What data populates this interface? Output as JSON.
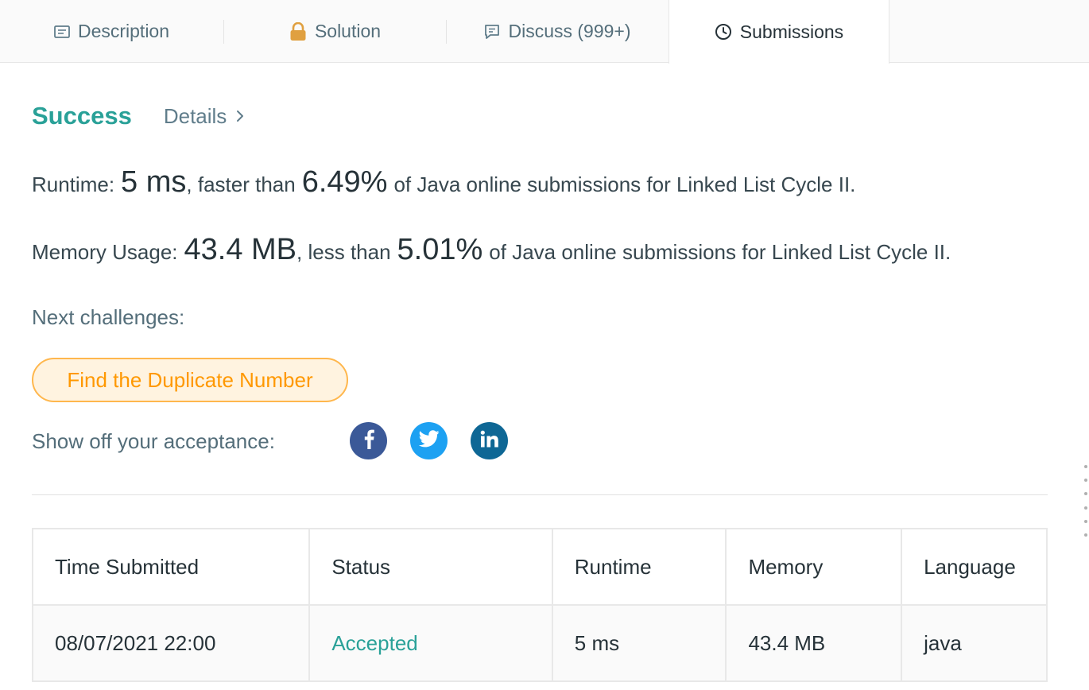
{
  "tabs": [
    {
      "label": "Description",
      "icon": "description-icon"
    },
    {
      "label": "Solution",
      "icon": "lock-icon"
    },
    {
      "label": "Discuss (999+)",
      "icon": "discuss-icon"
    },
    {
      "label": "Submissions",
      "icon": "clock-icon",
      "active": true
    }
  ],
  "result": {
    "status": "Success",
    "details_label": "Details",
    "runtime": {
      "label": "Runtime:",
      "value": "5 ms",
      "comparator": ", faster than",
      "percent": "6.49%",
      "suffix": "of Java online submissions for Linked List Cycle II."
    },
    "memory": {
      "label": "Memory Usage:",
      "value": "43.4 MB",
      "comparator": ", less than",
      "percent": "5.01%",
      "suffix": "of Java online submissions for Linked List Cycle II."
    }
  },
  "next": {
    "label": "Next challenges:",
    "challenge": "Find the Duplicate Number"
  },
  "share": {
    "label": "Show off your acceptance:",
    "networks": [
      "facebook",
      "twitter",
      "linkedin"
    ]
  },
  "table": {
    "headers": [
      "Time Submitted",
      "Status",
      "Runtime",
      "Memory",
      "Language"
    ],
    "rows": [
      [
        "08/07/2021 22:00",
        "Accepted",
        "5 ms",
        "43.4 MB",
        "java"
      ]
    ]
  },
  "colors": {
    "success": "#2aa198",
    "challenge": "#ff9800",
    "facebook": "#3b5998",
    "twitter": "#1da1f2",
    "linkedin": "#0e6795"
  }
}
